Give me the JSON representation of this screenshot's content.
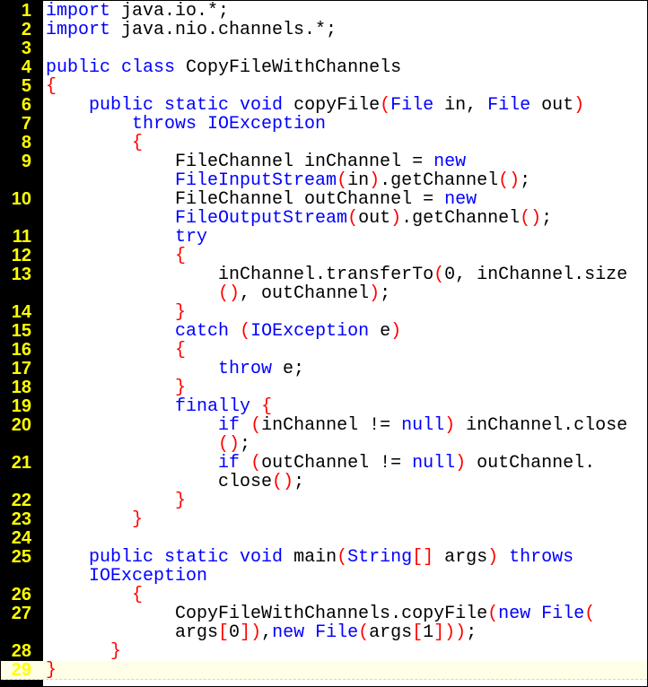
{
  "colors": {
    "keyword": "#0000ff",
    "bracket": "#ff0000",
    "text": "#000000",
    "line_number": "#ffff00",
    "gutter": "#000000",
    "current_line": "#ffffe8"
  },
  "rows": [
    {
      "ln": "1",
      "tokens": [
        [
          "kw",
          "import"
        ],
        [
          "t",
          " java.io.*;"
        ]
      ]
    },
    {
      "ln": "2",
      "tokens": [
        [
          "kw",
          "import"
        ],
        [
          "t",
          " java.nio.channels.*;"
        ]
      ]
    },
    {
      "ln": "3",
      "tokens": []
    },
    {
      "ln": "4",
      "tokens": [
        [
          "kw",
          "public class"
        ],
        [
          "t",
          " CopyFileWithChannels"
        ]
      ]
    },
    {
      "ln": "5",
      "tokens": [
        [
          "br",
          "{"
        ]
      ]
    },
    {
      "ln": "6",
      "tokens": [
        [
          "t",
          "    "
        ],
        [
          "kw",
          "public static void"
        ],
        [
          "t",
          " copyFile"
        ],
        [
          "br",
          "("
        ],
        [
          "kw",
          "File"
        ],
        [
          "t",
          " in, "
        ],
        [
          "kw",
          "File"
        ],
        [
          "t",
          " out"
        ],
        [
          "br",
          ")"
        ]
      ]
    },
    {
      "ln": "7",
      "tokens": [
        [
          "t",
          "        "
        ],
        [
          "kw",
          "throws IOException"
        ]
      ]
    },
    {
      "ln": "8",
      "tokens": [
        [
          "t",
          "        "
        ],
        [
          "br",
          "{"
        ]
      ]
    },
    {
      "ln": "9",
      "tokens": [
        [
          "t",
          "            FileChannel inChannel = "
        ],
        [
          "kw",
          "new"
        ]
      ]
    },
    {
      "ln": "",
      "tokens": [
        [
          "t",
          "            "
        ],
        [
          "kw",
          "FileInputStream"
        ],
        [
          "br",
          "("
        ],
        [
          "t",
          "in"
        ],
        [
          "br",
          ")"
        ],
        [
          "t",
          ".getChannel"
        ],
        [
          "br",
          "()"
        ],
        [
          "t",
          ";"
        ]
      ]
    },
    {
      "ln": "10",
      "tokens": [
        [
          "t",
          "            FileChannel outChannel = "
        ],
        [
          "kw",
          "new"
        ]
      ]
    },
    {
      "ln": "",
      "tokens": [
        [
          "t",
          "            "
        ],
        [
          "kw",
          "FileOutputStream"
        ],
        [
          "br",
          "("
        ],
        [
          "t",
          "out"
        ],
        [
          "br",
          ")"
        ],
        [
          "t",
          ".getChannel"
        ],
        [
          "br",
          "()"
        ],
        [
          "t",
          ";"
        ]
      ]
    },
    {
      "ln": "11",
      "tokens": [
        [
          "t",
          "            "
        ],
        [
          "kw",
          "try"
        ]
      ]
    },
    {
      "ln": "12",
      "tokens": [
        [
          "t",
          "            "
        ],
        [
          "br",
          "{"
        ]
      ]
    },
    {
      "ln": "13",
      "tokens": [
        [
          "t",
          "                inChannel.transferTo"
        ],
        [
          "br",
          "("
        ],
        [
          "t",
          "0, inChannel.size"
        ]
      ]
    },
    {
      "ln": "",
      "tokens": [
        [
          "t",
          "                "
        ],
        [
          "br",
          "()"
        ],
        [
          "t",
          ", outChannel"
        ],
        [
          "br",
          ")"
        ],
        [
          "t",
          ";"
        ]
      ]
    },
    {
      "ln": "14",
      "tokens": [
        [
          "t",
          "            "
        ],
        [
          "br",
          "}"
        ]
      ]
    },
    {
      "ln": "15",
      "tokens": [
        [
          "t",
          "            "
        ],
        [
          "kw",
          "catch"
        ],
        [
          "t",
          " "
        ],
        [
          "br",
          "("
        ],
        [
          "kw",
          "IOException"
        ],
        [
          "t",
          " e"
        ],
        [
          "br",
          ")"
        ]
      ]
    },
    {
      "ln": "16",
      "tokens": [
        [
          "t",
          "            "
        ],
        [
          "br",
          "{"
        ]
      ]
    },
    {
      "ln": "17",
      "tokens": [
        [
          "t",
          "                "
        ],
        [
          "kw",
          "throw"
        ],
        [
          "t",
          " e;"
        ]
      ]
    },
    {
      "ln": "18",
      "tokens": [
        [
          "t",
          "            "
        ],
        [
          "br",
          "}"
        ]
      ]
    },
    {
      "ln": "19",
      "tokens": [
        [
          "t",
          "            "
        ],
        [
          "kw",
          "finally"
        ],
        [
          "t",
          " "
        ],
        [
          "br",
          "{"
        ]
      ]
    },
    {
      "ln": "20",
      "tokens": [
        [
          "t",
          "                "
        ],
        [
          "kw",
          "if"
        ],
        [
          "t",
          " "
        ],
        [
          "br",
          "("
        ],
        [
          "t",
          "inChannel != "
        ],
        [
          "kw",
          "null"
        ],
        [
          "br",
          ")"
        ],
        [
          "t",
          " inChannel.close"
        ]
      ]
    },
    {
      "ln": "",
      "tokens": [
        [
          "t",
          "                "
        ],
        [
          "br",
          "()"
        ],
        [
          "t",
          ";"
        ]
      ]
    },
    {
      "ln": "21",
      "tokens": [
        [
          "t",
          "                "
        ],
        [
          "kw",
          "if"
        ],
        [
          "t",
          " "
        ],
        [
          "br",
          "("
        ],
        [
          "t",
          "outChannel != "
        ],
        [
          "kw",
          "null"
        ],
        [
          "br",
          ")"
        ],
        [
          "t",
          " outChannel."
        ]
      ]
    },
    {
      "ln": "",
      "tokens": [
        [
          "t",
          "                close"
        ],
        [
          "br",
          "()"
        ],
        [
          "t",
          ";"
        ]
      ]
    },
    {
      "ln": "22",
      "tokens": [
        [
          "t",
          "            "
        ],
        [
          "br",
          "}"
        ]
      ]
    },
    {
      "ln": "23",
      "tokens": [
        [
          "t",
          "        "
        ],
        [
          "br",
          "}"
        ]
      ]
    },
    {
      "ln": "24",
      "tokens": []
    },
    {
      "ln": "25",
      "tokens": [
        [
          "t",
          "    "
        ],
        [
          "kw",
          "public static void"
        ],
        [
          "t",
          " main"
        ],
        [
          "br",
          "("
        ],
        [
          "kw",
          "String"
        ],
        [
          "br",
          "[]"
        ],
        [
          "t",
          " args"
        ],
        [
          "br",
          ")"
        ],
        [
          "t",
          " "
        ],
        [
          "kw",
          "throws"
        ]
      ]
    },
    {
      "ln": "",
      "tokens": [
        [
          "t",
          "    "
        ],
        [
          "kw",
          "IOException"
        ]
      ]
    },
    {
      "ln": "26",
      "tokens": [
        [
          "t",
          "        "
        ],
        [
          "br",
          "{"
        ]
      ]
    },
    {
      "ln": "27",
      "tokens": [
        [
          "t",
          "            CopyFileWithChannels.copyFile"
        ],
        [
          "br",
          "("
        ],
        [
          "kw",
          "new File"
        ],
        [
          "br",
          "("
        ]
      ]
    },
    {
      "ln": "",
      "tokens": [
        [
          "t",
          "            args"
        ],
        [
          "br",
          "["
        ],
        [
          "t",
          "0"
        ],
        [
          "br",
          "])"
        ],
        [
          "t",
          ","
        ],
        [
          "kw",
          "new File"
        ],
        [
          "br",
          "("
        ],
        [
          "t",
          "args"
        ],
        [
          "br",
          "["
        ],
        [
          "t",
          "1"
        ],
        [
          "br",
          "]))"
        ],
        [
          "t",
          ";"
        ]
      ]
    },
    {
      "ln": "28",
      "tokens": [
        [
          "t",
          "      "
        ],
        [
          "br",
          "}"
        ]
      ]
    },
    {
      "ln": "29",
      "tokens": [
        [
          "br",
          "}"
        ]
      ],
      "current": true
    }
  ]
}
